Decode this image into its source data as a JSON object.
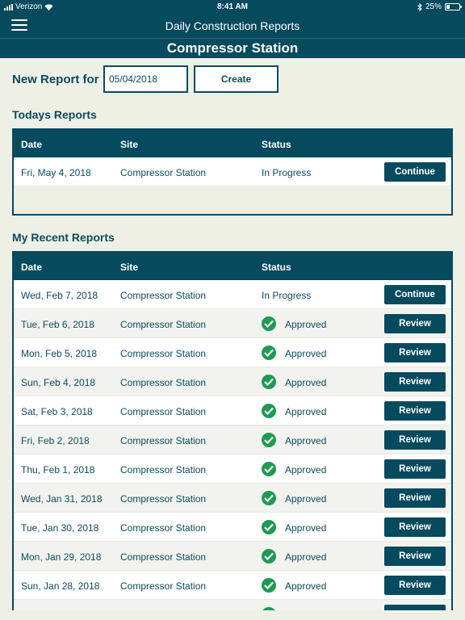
{
  "status_bar": {
    "carrier": "Verizon",
    "time": "8:41 AM",
    "battery": "25%",
    "battery_level": 0.25
  },
  "nav": {
    "title": "Daily Construction Reports",
    "station": "Compressor Station"
  },
  "new_report": {
    "label": "New Report for",
    "date_value": "05/04/2018",
    "create_label": "Create"
  },
  "today": {
    "title": "Todays Reports",
    "headers": {
      "date": "Date",
      "site": "Site",
      "status": "Status"
    },
    "rows": [
      {
        "date": "Fri, May 4, 2018",
        "site": "Compressor Station",
        "status": "In Progress",
        "action": "Continue"
      }
    ]
  },
  "recent": {
    "title": "My Recent Reports",
    "headers": {
      "date": "Date",
      "site": "Site",
      "status": "Status"
    },
    "rows": [
      {
        "date": "Wed, Feb 7, 2018",
        "site": "Compressor Station",
        "status": "In Progress",
        "action": "Continue"
      },
      {
        "date": "Tue, Feb 6, 2018",
        "site": "Compressor Station",
        "status": "Approved",
        "action": "Review"
      },
      {
        "date": "Mon, Feb 5, 2018",
        "site": "Compressor Station",
        "status": "Approved",
        "action": "Review"
      },
      {
        "date": "Sun, Feb 4, 2018",
        "site": "Compressor Station",
        "status": "Approved",
        "action": "Review"
      },
      {
        "date": "Sat, Feb 3, 2018",
        "site": "Compressor Station",
        "status": "Approved",
        "action": "Review"
      },
      {
        "date": "Fri, Feb 2, 2018",
        "site": "Compressor Station",
        "status": "Approved",
        "action": "Review"
      },
      {
        "date": "Thu, Feb 1, 2018",
        "site": "Compressor Station",
        "status": "Approved",
        "action": "Review"
      },
      {
        "date": "Wed, Jan 31, 2018",
        "site": "Compressor Station",
        "status": "Approved",
        "action": "Review"
      },
      {
        "date": "Tue, Jan 30, 2018",
        "site": "Compressor Station",
        "status": "Approved",
        "action": "Review"
      },
      {
        "date": "Mon, Jan 29, 2018",
        "site": "Compressor Station",
        "status": "Approved",
        "action": "Review"
      },
      {
        "date": "Sun, Jan 28, 2018",
        "site": "Compressor Station",
        "status": "Approved",
        "action": "Review"
      },
      {
        "date": "",
        "site": "",
        "status": "Approved",
        "action": ""
      }
    ]
  },
  "colors": {
    "primary": "#064a5e",
    "approved": "#1e9a52",
    "background": "#eef0e6"
  },
  "icons": {
    "menu": "hamburger-icon",
    "approved": "check-circle-icon"
  }
}
